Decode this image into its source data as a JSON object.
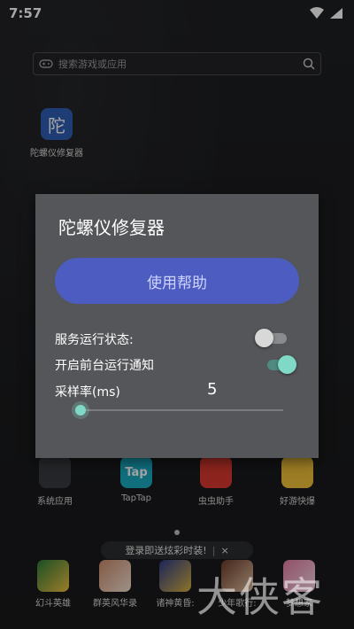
{
  "status_bar": {
    "time": "7:57"
  },
  "search": {
    "placeholder": "搜索游戏或应用"
  },
  "desktop_apps": [
    {
      "label": "陀螺仪修复器",
      "glyph": "陀"
    }
  ],
  "dialog": {
    "title": "陀螺仪修复器",
    "help_button": "使用帮助",
    "service_status_label": "服务运行状态:",
    "service_status_on": false,
    "foreground_notify_label": "开启前台运行通知",
    "foreground_notify_on": true,
    "sample_rate_label": "采样率(ms)",
    "sample_rate_value": "5"
  },
  "home_row_apps": [
    {
      "label": "系统应用"
    },
    {
      "label": "TapTap",
      "glyph": "Tap"
    },
    {
      "label": "虫虫助手"
    },
    {
      "label": "好游快爆"
    }
  ],
  "banner": {
    "text": "登录即送炫彩时装!",
    "close": "×"
  },
  "dock_apps": [
    {
      "label": "幻斗英雄"
    },
    {
      "label": "群英风华录"
    },
    {
      "label": "诸神黄昏:"
    },
    {
      "label": "少年歌行:"
    },
    {
      "label": "梦想家"
    }
  ],
  "watermark": {
    "text": "大侠客"
  },
  "colors": {
    "accent": "#4c5cc0",
    "toggle_on": "#7fd9c6",
    "dialog_bg": "#555659"
  }
}
